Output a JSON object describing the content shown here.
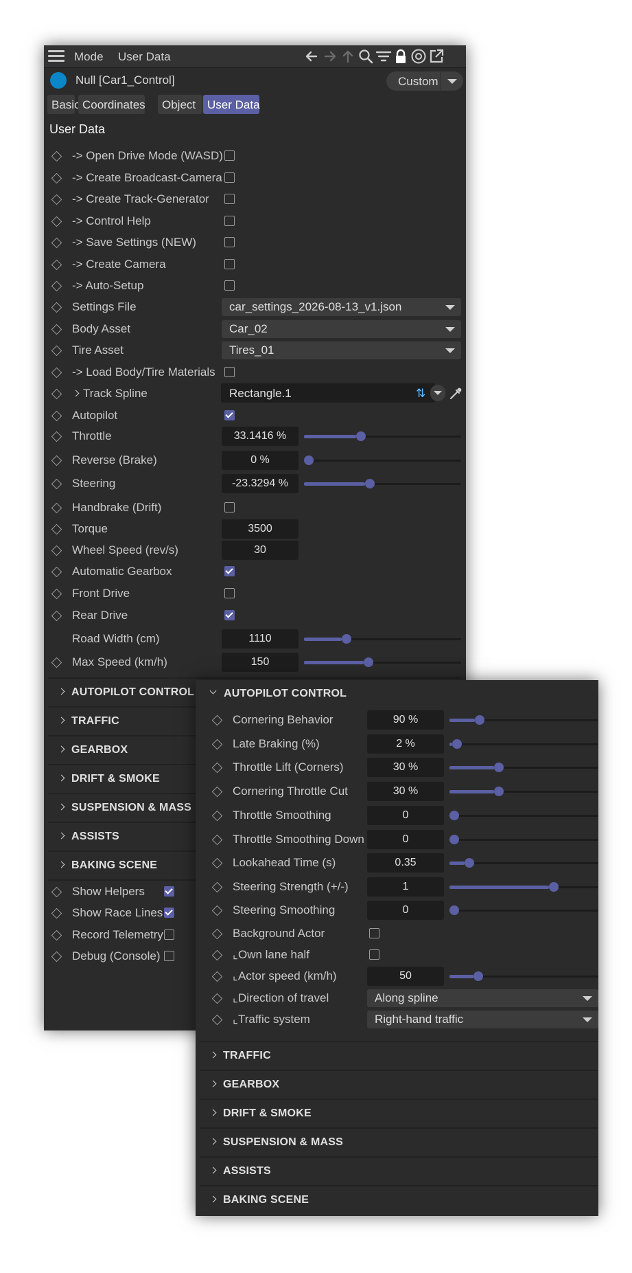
{
  "toolbar": {
    "menu_icon": "hamburger-icon",
    "mode": "Mode",
    "user_data": "User Data",
    "icons": [
      "arrow-left-icon",
      "arrow-right-icon",
      "arrow-up-icon",
      "search-icon",
      "filter-icon",
      "lock-icon",
      "target-icon",
      "open-new-window-icon"
    ]
  },
  "object": {
    "name": "Null [Car1_Control]",
    "preset": "Custom",
    "dot_color": "#0b86c9"
  },
  "tabs": [
    "Basic",
    "Coordinates",
    "Object",
    "User Data"
  ],
  "active_tab": "User Data",
  "section_title": "User Data",
  "rows": {
    "open_drive": "-> Open Drive Mode (WASD)",
    "broadcast_camera": "-> Create Broadcast-Camera",
    "track_generator": "-> Create Track-Generator",
    "control_help": "-> Control Help",
    "save_settings": "-> Save Settings (NEW)",
    "create_camera": "-> Create Camera",
    "auto_setup": "-> Auto-Setup",
    "settings_file": {
      "label": "Settings File",
      "value": "car_settings_2026-08-13_v1.json"
    },
    "body_asset": {
      "label": "Body Asset",
      "value": "Car_02"
    },
    "tire_asset": {
      "label": "Tire Asset",
      "value": "Tires_01"
    },
    "load_materials": "-> Load Body/Tire Materials",
    "track_spline": {
      "label": "Track Spline",
      "value": "Rectangle.1"
    },
    "autopilot": "Autopilot",
    "throttle": {
      "label": "Throttle",
      "value": "33.1416 %",
      "level": 0.33
    },
    "reverse": {
      "label": "Reverse (Brake)",
      "value": "0 %",
      "level": 0.0
    },
    "steering": {
      "label": "Steering",
      "value": "-23.3294 %",
      "level": 0.39
    },
    "handbrake": "Handbrake (Drift)",
    "torque": {
      "label": "Torque",
      "value": "3500"
    },
    "wheel_speed": {
      "label": "Wheel Speed (rev/s)",
      "value": "30"
    },
    "auto_gearbox": "Automatic Gearbox",
    "front_drive": "Front Drive",
    "rear_drive": "Rear Drive",
    "road_width": {
      "label": "Road Width (cm)",
      "value": "1110",
      "level": 0.24
    },
    "max_speed": {
      "label": "Max Speed (km/h)",
      "value": "150",
      "level": 0.38
    }
  },
  "groups": [
    "AUTOPILOT CONTROL",
    "TRAFFIC",
    "GEARBOX",
    "DRIFT & SMOKE",
    "SUSPENSION & MASS",
    "ASSISTS",
    "BAKING SCENE"
  ],
  "bottom_rows": {
    "show_helpers": "Show Helpers",
    "show_race_lines": "Show Race Lines",
    "record_telemetry": "Record Telemetry",
    "debug_console": "Debug (Console)"
  },
  "autopilot_panel": {
    "title": "AUTOPILOT CONTROL",
    "cornering_behavior": {
      "label": "Cornering Behavior",
      "value": "90 %",
      "level": 0.17
    },
    "late_braking": {
      "label": "Late Braking (%)",
      "value": "2 %",
      "level": 0.02
    },
    "throttle_lift": {
      "label": "Throttle Lift (Corners)",
      "value": "30 %",
      "level": 0.3
    },
    "cornering_throttle_cut": {
      "label": "Cornering Throttle Cut",
      "value": "30 %",
      "level": 0.3
    },
    "throttle_smoothing": {
      "label": "Throttle Smoothing",
      "value": "0",
      "level": 0.0
    },
    "throttle_smoothing_down": {
      "label": "Throttle Smoothing Down",
      "value": "0",
      "level": 0.0
    },
    "lookahead_time": {
      "label": "Lookahead Time (s)",
      "value": "0.35",
      "level": 0.1
    },
    "steering_strength": {
      "label": "Steering Strength (+/-)",
      "value": "1",
      "level": 0.67
    },
    "steering_smoothing": {
      "label": "Steering Smoothing",
      "value": "0",
      "level": 0.0
    },
    "background_actor": "Background Actor",
    "own_lane_half": "⌞Own lane half",
    "actor_speed": {
      "label": "⌞Actor speed (km/h)",
      "value": "50",
      "level": 0.16
    },
    "direction_of_travel": {
      "label": "⌞Direction of travel",
      "value": "Along spline"
    },
    "traffic_system": {
      "label": "⌞Traffic system",
      "value": "Right-hand traffic"
    }
  },
  "autopilot_groups": [
    "TRAFFIC",
    "GEARBOX",
    "DRIFT & SMOKE",
    "SUSPENSION & MASS",
    "ASSISTS",
    "BAKING SCENE"
  ],
  "colors": {
    "accent": "#5b5fa3",
    "panel": "#2b2b2b",
    "field": "#1d1d1d"
  }
}
